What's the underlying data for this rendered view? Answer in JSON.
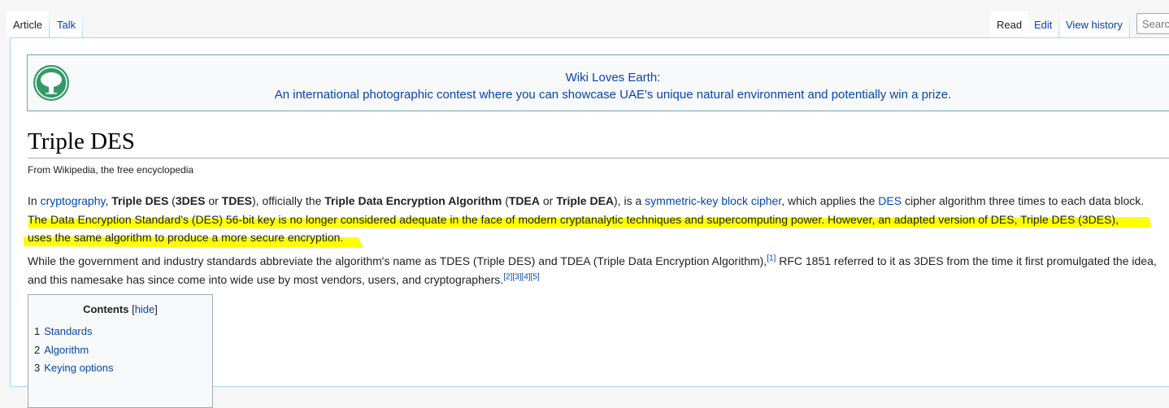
{
  "tabs": {
    "left": [
      {
        "label": "Article",
        "selected": true
      },
      {
        "label": "Talk",
        "selected": false
      }
    ],
    "right": [
      {
        "label": "Read",
        "selected": true
      },
      {
        "label": "Edit",
        "selected": false
      },
      {
        "label": "View history",
        "selected": false
      }
    ]
  },
  "search": {
    "placeholder": "Search Wikipedia",
    "visible_text": "Searc"
  },
  "banner": {
    "icon": "tree-icon",
    "line1": "Wiki Loves Earth:",
    "line2": "An international photographic contest where you can showcase UAE's unique natural environment and potentially win a prize."
  },
  "page": {
    "title": "Triple DES",
    "tagline": "From Wikipedia, the free encyclopedia"
  },
  "para1": {
    "t1": "In ",
    "link_cryptography": "cryptography",
    "t2": ", ",
    "b_triple_des": "Triple DES",
    "t3": " (",
    "b_3des": "3DES",
    "t4": " or ",
    "b_tdes": "TDES",
    "t5": "), officially the ",
    "b_tdea_full": "Triple Data Encryption Algorithm",
    "t6": " (",
    "b_tdea": "TDEA",
    "t7": " or ",
    "b_triple_dea": "Triple DEA",
    "t8": "), is a ",
    "link_symmetric": "symmetric-key block cipher",
    "t9": ", which applies the ",
    "link_des": "DES",
    "t10": " cipher algorithm three times to each data block.",
    "highlight_line1": "The Data Encryption Standard's (DES) 56-bit key is no longer considered adequate in the face of modern cryptanalytic techniques and supercomputing power. However, an adapted version of DES, Triple DES (3DES),",
    "highlight_line2": "uses the same algorithm to produce a more secure encryption."
  },
  "para2": {
    "t1": "While the government and industry standards abbreviate the algorithm's name as TDES (Triple DES) and TDEA (Triple Data Encryption Algorithm),",
    "ref1": "[1]",
    "t2": " RFC 1851 referred to it as 3DES from the time it first promulgated the idea, and this namesake has since come into wide use by most vendors, users, and cryptographers.",
    "ref2": "[2]",
    "ref3": "[3]",
    "ref4": "[4]",
    "ref5": "[5]"
  },
  "toc": {
    "title": "Contents",
    "bracket_open": "[",
    "toggle": "hide",
    "bracket_close": "]",
    "items": [
      {
        "num": "1",
        "label": "Standards"
      },
      {
        "num": "2",
        "label": "Algorithm"
      },
      {
        "num": "3",
        "label": "Keying options"
      }
    ]
  },
  "colors": {
    "link": "#0645ad",
    "highlight": "#ffff00",
    "banner_icon": "#339966",
    "tab_border": "#a7d7f9"
  }
}
